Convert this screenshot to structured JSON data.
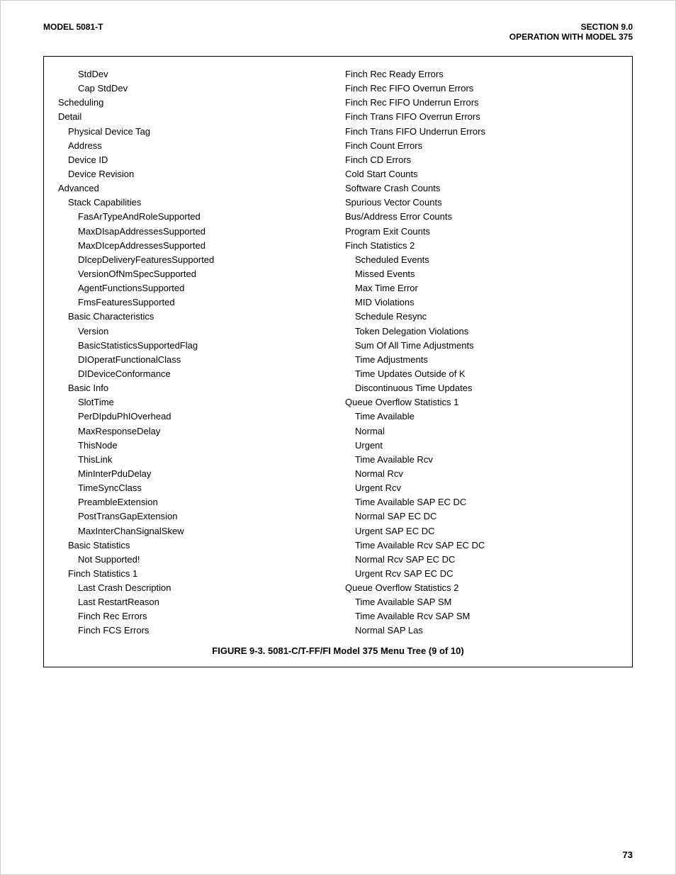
{
  "header": {
    "left": "MODEL 5081-T",
    "right_line1": "SECTION 9.0",
    "right_line2": "OPERATION WITH MODEL 375"
  },
  "left_column": [
    {
      "text": "StdDev",
      "indent": 2
    },
    {
      "text": "Cap StdDev",
      "indent": 2
    },
    {
      "text": "Scheduling",
      "indent": 0
    },
    {
      "text": "Detail",
      "indent": 0
    },
    {
      "text": "Physical Device Tag",
      "indent": 1
    },
    {
      "text": "Address",
      "indent": 1
    },
    {
      "text": "Device ID",
      "indent": 1
    },
    {
      "text": "Device Revision",
      "indent": 1
    },
    {
      "text": "Advanced",
      "indent": 0
    },
    {
      "text": "Stack Capabilities",
      "indent": 1
    },
    {
      "text": "FasArTypeAndRoleSupported",
      "indent": 2
    },
    {
      "text": "MaxDIsapAddressesSupported",
      "indent": 2
    },
    {
      "text": "MaxDIcepAddressesSupported",
      "indent": 2
    },
    {
      "text": "DIcepDeliveryFeaturesSupported",
      "indent": 2
    },
    {
      "text": "VersionOfNmSpecSupported",
      "indent": 2
    },
    {
      "text": "AgentFunctionsSupported",
      "indent": 2
    },
    {
      "text": "FmsFeaturesSupported",
      "indent": 2
    },
    {
      "text": "Basic Characteristics",
      "indent": 1
    },
    {
      "text": "Version",
      "indent": 2
    },
    {
      "text": "BasicStatisticsSupportedFlag",
      "indent": 2
    },
    {
      "text": "DIOperatFunctionalClass",
      "indent": 2
    },
    {
      "text": "DIDeviceConformance",
      "indent": 2
    },
    {
      "text": "Basic Info",
      "indent": 1
    },
    {
      "text": "SlotTime",
      "indent": 2
    },
    {
      "text": "PerDIpduPhIOverhead",
      "indent": 2
    },
    {
      "text": "MaxResponseDelay",
      "indent": 2
    },
    {
      "text": "ThisNode",
      "indent": 2
    },
    {
      "text": "ThisLink",
      "indent": 2
    },
    {
      "text": "MinInterPduDelay",
      "indent": 2
    },
    {
      "text": "TimeSyncClass",
      "indent": 2
    },
    {
      "text": "PreambleExtension",
      "indent": 2
    },
    {
      "text": "PostTransGapExtension",
      "indent": 2
    },
    {
      "text": "MaxInterChanSignalSkew",
      "indent": 2
    },
    {
      "text": "Basic Statistics",
      "indent": 1
    },
    {
      "text": "Not Supported!",
      "indent": 2
    },
    {
      "text": "Finch Statistics 1",
      "indent": 1
    },
    {
      "text": "Last Crash Description",
      "indent": 2
    },
    {
      "text": "Last RestartReason",
      "indent": 2
    },
    {
      "text": "Finch Rec Errors",
      "indent": 2
    },
    {
      "text": "Finch FCS Errors",
      "indent": 2
    }
  ],
  "right_column": [
    {
      "text": "Finch Rec Ready Errors",
      "indent": 0
    },
    {
      "text": "Finch Rec FIFO Overrun Errors",
      "indent": 0
    },
    {
      "text": "Finch Rec FIFO Underrun Errors",
      "indent": 0
    },
    {
      "text": "Finch Trans FIFO Overrun Errors",
      "indent": 0
    },
    {
      "text": "Finch Trans FIFO Underrun Errors",
      "indent": 0
    },
    {
      "text": "Finch Count Errors",
      "indent": 0
    },
    {
      "text": "Finch CD Errors",
      "indent": 0
    },
    {
      "text": "Cold Start Counts",
      "indent": 0
    },
    {
      "text": "Software Crash Counts",
      "indent": 0
    },
    {
      "text": "Spurious Vector Counts",
      "indent": 0
    },
    {
      "text": "Bus/Address Error Counts",
      "indent": 0
    },
    {
      "text": "Program Exit Counts",
      "indent": 0
    },
    {
      "text": "Finch Statistics 2",
      "indent": 0
    },
    {
      "text": "Scheduled Events",
      "indent": 1
    },
    {
      "text": "Missed Events",
      "indent": 1
    },
    {
      "text": "Max Time Error",
      "indent": 1
    },
    {
      "text": "MID Violations",
      "indent": 1
    },
    {
      "text": "Schedule Resync",
      "indent": 1
    },
    {
      "text": "Token Delegation Violations",
      "indent": 1
    },
    {
      "text": "Sum Of All Time Adjustments",
      "indent": 1
    },
    {
      "text": "Time Adjustments",
      "indent": 1
    },
    {
      "text": "Time Updates Outside of K",
      "indent": 1
    },
    {
      "text": "Discontinuous Time Updates",
      "indent": 1
    },
    {
      "text": "Queue Overflow Statistics 1",
      "indent": 0
    },
    {
      "text": "Time Available",
      "indent": 1
    },
    {
      "text": "Normal",
      "indent": 1
    },
    {
      "text": "Urgent",
      "indent": 1
    },
    {
      "text": "Time Available Rcv",
      "indent": 1
    },
    {
      "text": "Normal Rcv",
      "indent": 1
    },
    {
      "text": "Urgent Rcv",
      "indent": 1
    },
    {
      "text": "Time Available SAP EC DC",
      "indent": 1
    },
    {
      "text": "Normal SAP EC DC",
      "indent": 1
    },
    {
      "text": "Urgent SAP EC DC",
      "indent": 1
    },
    {
      "text": "Time Available Rcv SAP EC DC",
      "indent": 1
    },
    {
      "text": "Normal Rcv SAP EC DC",
      "indent": 1
    },
    {
      "text": "Urgent Rcv SAP EC DC",
      "indent": 1
    },
    {
      "text": "Queue Overflow Statistics 2",
      "indent": 0
    },
    {
      "text": "Time Available SAP SM",
      "indent": 1
    },
    {
      "text": "Time Available Rcv SAP SM",
      "indent": 1
    },
    {
      "text": "Normal SAP Las",
      "indent": 1
    }
  ],
  "caption": "FIGURE 9-3. 5081-C/T-FF/FI Model 375 Menu Tree (9 of 10)",
  "page_number": "73"
}
